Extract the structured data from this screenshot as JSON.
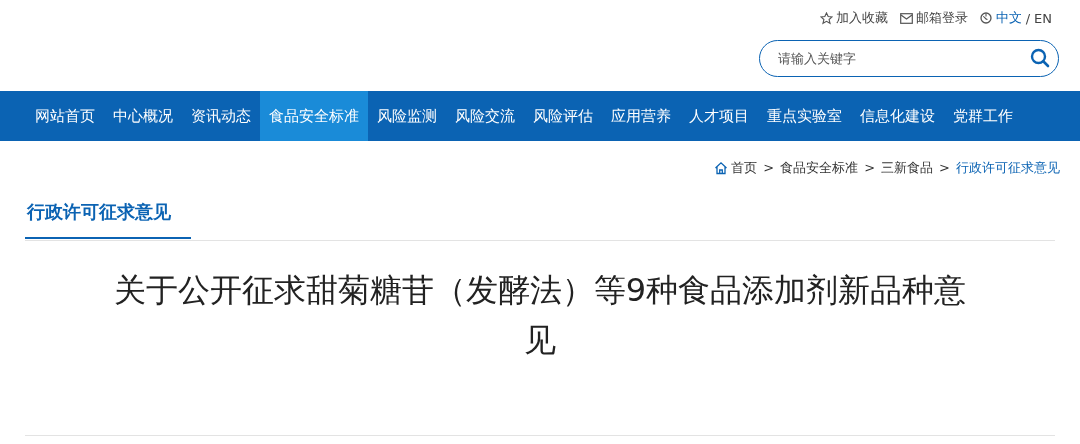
{
  "top_links": [
    {
      "kind": "favorite",
      "label": "加入收藏"
    },
    {
      "kind": "mail",
      "label": "邮箱登录"
    }
  ],
  "language": {
    "current": "中文",
    "separator": "/",
    "other": "EN"
  },
  "search": {
    "placeholder": "请输入关键字"
  },
  "nav": [
    {
      "label": "网站首页",
      "selected": false
    },
    {
      "label": "中心概况",
      "selected": false
    },
    {
      "label": "资讯动态",
      "selected": false
    },
    {
      "label": "食品安全标准",
      "selected": true
    },
    {
      "label": "风险监测",
      "selected": false
    },
    {
      "label": "风险交流",
      "selected": false
    },
    {
      "label": "风险评估",
      "selected": false
    },
    {
      "label": "应用营养",
      "selected": false
    },
    {
      "label": "人才项目",
      "selected": false
    },
    {
      "label": "重点实验室",
      "selected": false
    },
    {
      "label": "信息化建设",
      "selected": false
    },
    {
      "label": "党群工作",
      "selected": false
    }
  ],
  "breadcrumb": [
    {
      "label": "首页"
    },
    {
      "label": "食品安全标准"
    },
    {
      "label": "三新食品"
    },
    {
      "label": "行政许可征求意见"
    }
  ],
  "breadcrumb_separator": ">",
  "section_title": "行政许可征求意见",
  "article_title": "关于公开征求甜菊糖苷（发酵法）等9种食品添加剂新品种意见"
}
